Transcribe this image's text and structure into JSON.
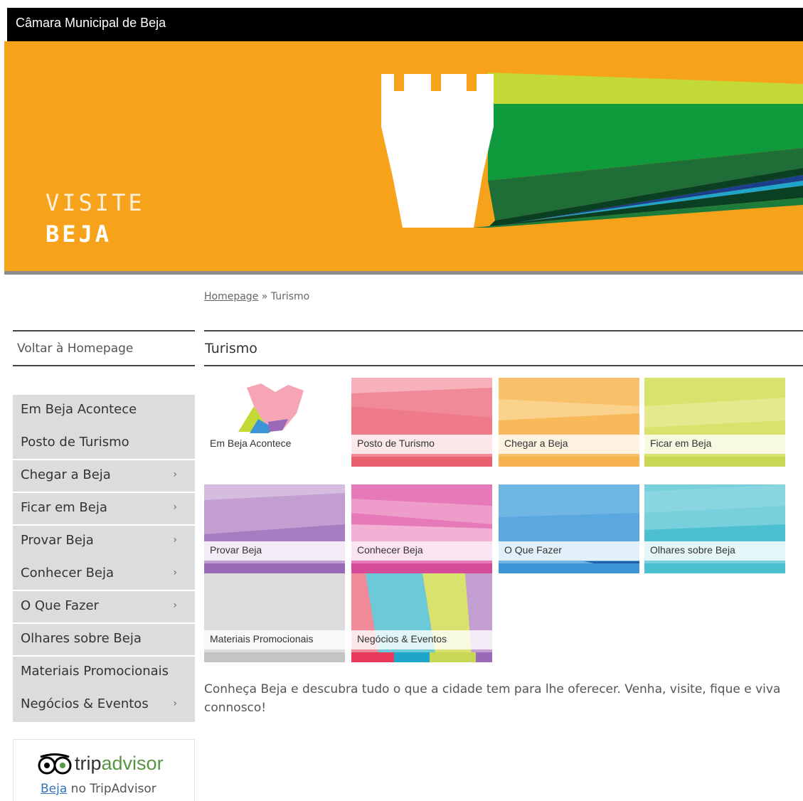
{
  "header": {
    "site_title": "Câmara Municipal de Beja"
  },
  "banner": {
    "line1": "VISITE",
    "line2": "BEJA"
  },
  "breadcrumb": {
    "home": "Homepage",
    "sep": "»",
    "current": "Turismo"
  },
  "sidebar": {
    "back_label": "Voltar à Homepage",
    "items": [
      {
        "label": "Em Beja Acontece",
        "arrow": ""
      },
      {
        "label": "Posto de Turismo",
        "arrow": ""
      },
      {
        "label": "Chegar a Beja",
        "arrow": "›"
      },
      {
        "label": "Ficar em Beja",
        "arrow": "›"
      },
      {
        "label": "Provar Beja",
        "arrow": "›"
      },
      {
        "label": "Conhecer Beja",
        "arrow": "›"
      },
      {
        "label": "O Que Fazer",
        "arrow": "›"
      },
      {
        "label": "Olhares sobre Beja",
        "arrow": ""
      },
      {
        "label": "Materiais Promocionais",
        "arrow": ""
      },
      {
        "label": "Negócios & Eventos",
        "arrow": "›"
      }
    ]
  },
  "tripadvisor": {
    "logo_text_a": "trip",
    "logo_text_b": "advisor",
    "link": "Beja",
    "suffix": " no TripAdvisor"
  },
  "main": {
    "title": "Turismo",
    "tiles": [
      {
        "label": "Em Beja Acontece"
      },
      {
        "label": "Posto de Turismo",
        "color": "#f08a98",
        "bar": "#e8606e"
      },
      {
        "label": "Chegar a Beja",
        "color": "#f9c06a",
        "bar": "#f6b350"
      },
      {
        "label": "Ficar em Beja",
        "color": "#d8e26c",
        "bar": "#c9d854"
      },
      {
        "label": "Provar Beja",
        "color": "#c29fd0",
        "bar": "#9a6ab8"
      },
      {
        "label": "Conhecer Beja",
        "color": "#e67ab8",
        "bar": "#d44c98"
      },
      {
        "label": "O Que Fazer",
        "color": "#6fb6e4",
        "bar": "#3b95d6"
      },
      {
        "label": "Olhares sobre Beja",
        "color": "#78d0dc",
        "bar": "#4cc0d0"
      },
      {
        "label": "Materiais Promocionais",
        "color": "#dcdcdc",
        "bar": "#c4c4c4"
      },
      {
        "label": "Negócios & Eventos"
      }
    ],
    "intro": "Conheça Beja e descubra tudo o que a cidade tem para lhe oferecer. Venha, visite, fique e viva connosco!"
  }
}
